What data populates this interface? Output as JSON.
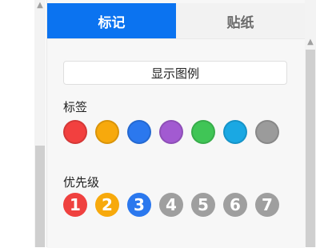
{
  "tabs": [
    {
      "label": "标记",
      "active": true
    },
    {
      "label": "贴纸",
      "active": false
    }
  ],
  "legend_button": {
    "label": "显示图例"
  },
  "tags": {
    "title": "标签",
    "colors": [
      "#f2403f",
      "#f7a90c",
      "#2b78ee",
      "#a25ad1",
      "#40c556",
      "#1aa8e3",
      "#9b9b9b"
    ]
  },
  "priority": {
    "title": "优先级",
    "items": [
      {
        "label": "1",
        "color": "#ef413f"
      },
      {
        "label": "2",
        "color": "#f7a90c"
      },
      {
        "label": "3",
        "color": "#2b78ee"
      },
      {
        "label": "4",
        "color": "#9f9f9f"
      },
      {
        "label": "5",
        "color": "#9f9f9f"
      },
      {
        "label": "6",
        "color": "#9f9f9f"
      },
      {
        "label": "7",
        "color": "#9f9f9f"
      }
    ]
  }
}
